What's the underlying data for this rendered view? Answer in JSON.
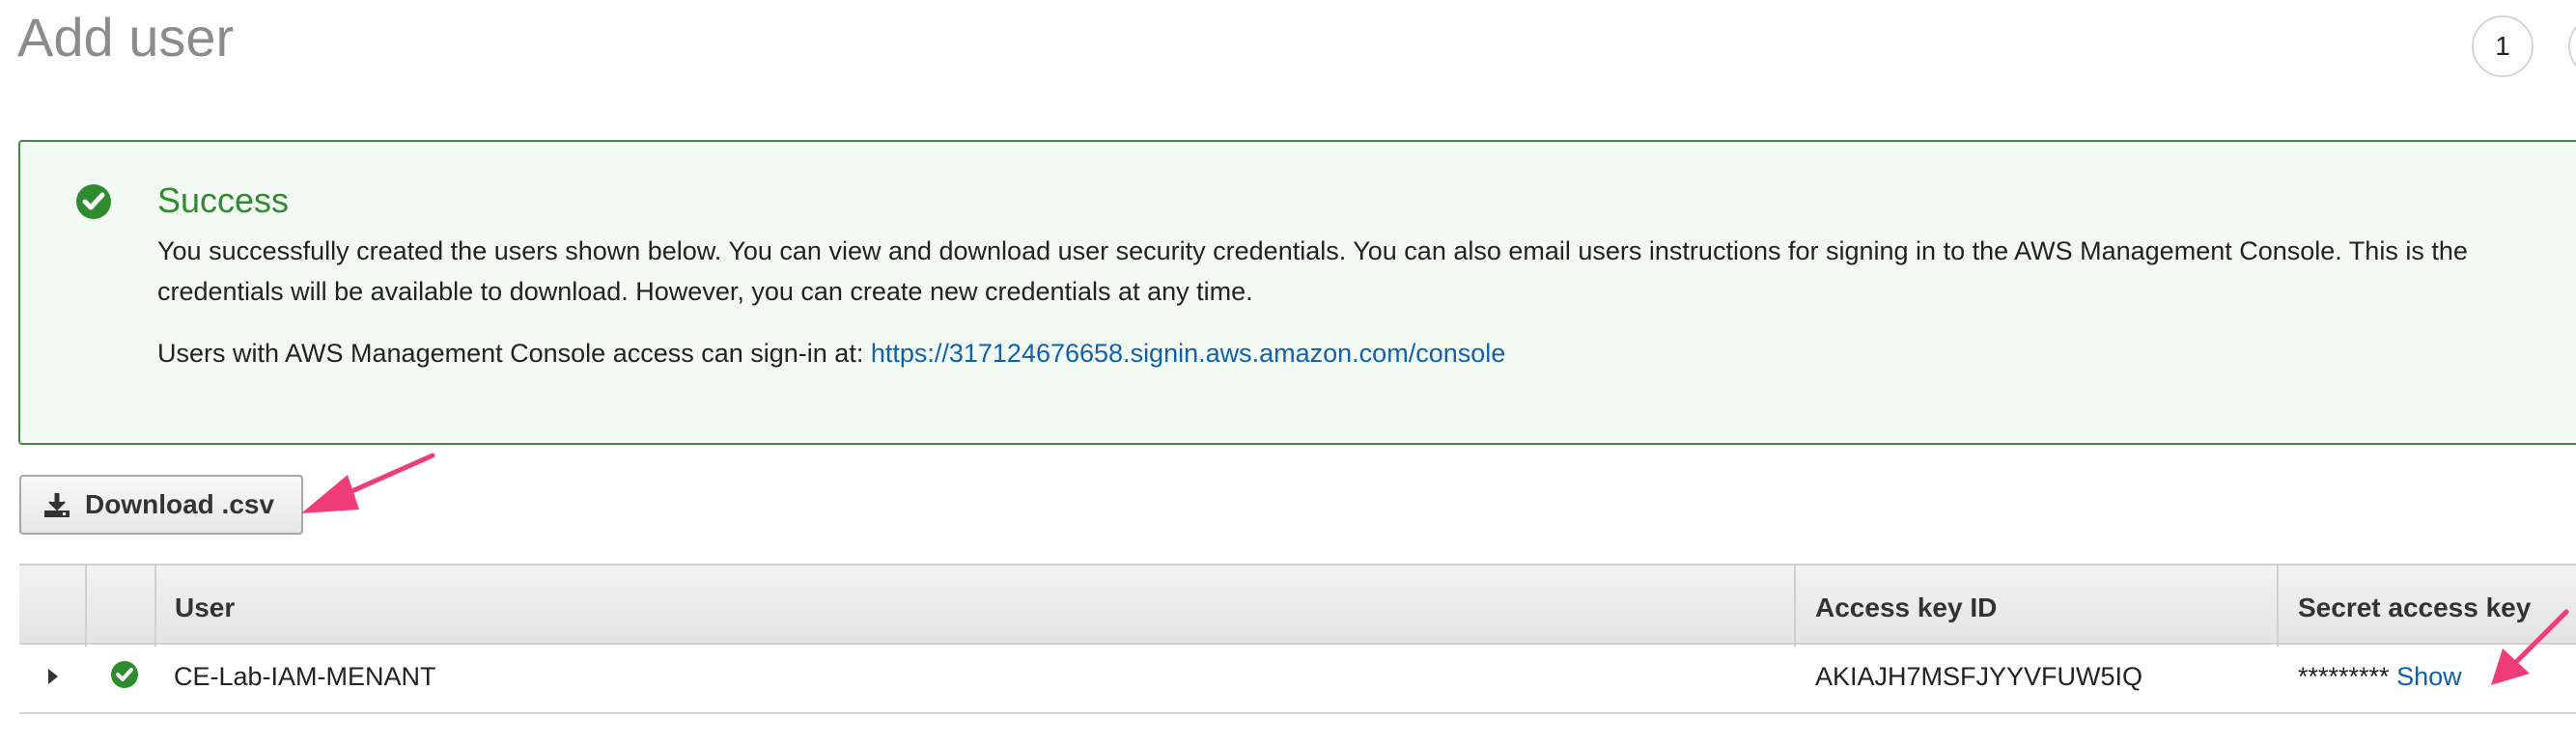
{
  "page": {
    "title": "Add user",
    "step_current": "1"
  },
  "alert": {
    "title": "Success",
    "line1": "You successfully created the users shown below. You can view and download user security credentials. You can also email users instructions for signing in to the AWS Management Console. This is the",
    "line2": "credentials will be available to download. However, you can create new credentials at any time.",
    "signin_prefix": "Users with AWS Management Console access can sign-in at: ",
    "signin_url": "https://317124676658.signin.aws.amazon.com/console",
    "status_color": "#2e8b2e"
  },
  "toolbar": {
    "download_label": "Download .csv"
  },
  "table": {
    "headers": {
      "user": "User",
      "access_key_id": "Access key ID",
      "secret_access_key": "Secret access key"
    },
    "rows": [
      {
        "user": "CE-Lab-IAM-MENANT",
        "access_key_id": "AKIAJH7MSFJYYVFUW5IQ",
        "secret_masked": "*********",
        "show_label": "Show"
      }
    ]
  },
  "annotations": {
    "arrow_color": "#f03c78"
  }
}
